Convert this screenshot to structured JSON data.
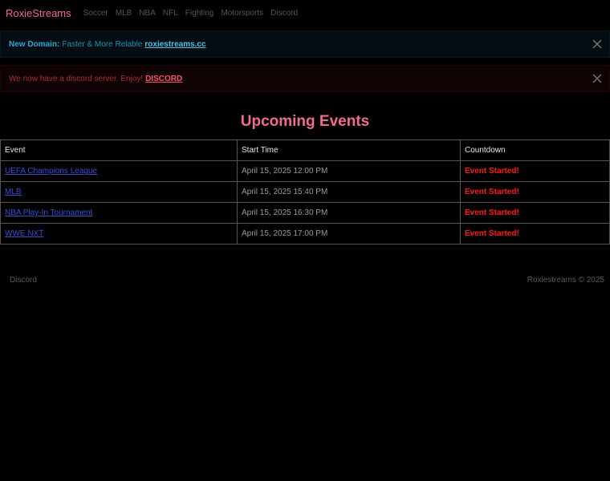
{
  "navbar": {
    "brand": "RoxieStreams",
    "links": [
      "Soccer",
      "MLB",
      "NBA",
      "NFL",
      "Fighting",
      "Motorsports",
      "Discord"
    ]
  },
  "alerts": {
    "domain": {
      "lead": "New Domain:",
      "text": "Faster & More Relable",
      "link": "roxiestreams.cc"
    },
    "discord": {
      "text": "We now have a discord server. Enjoy!",
      "link": "DISCORD"
    }
  },
  "main": {
    "title": "Upcoming Events",
    "table": {
      "headers": [
        "Event",
        "Start Time",
        "Countdown"
      ],
      "rows": [
        {
          "event": "UEFA Champions League",
          "start": "April 15, 2025 12:00 PM",
          "countdown": "Event Started!"
        },
        {
          "event": "MLB",
          "start": "April 15, 2025 15:40 PM",
          "countdown": "Event Started!"
        },
        {
          "event": "NBA Play-In Tournament",
          "start": "April 15, 2025 16:30 PM",
          "countdown": "Event Started!"
        },
        {
          "event": "WWE NXT",
          "start": "April 15, 2025 17:00 PM",
          "countdown": "Event Started!"
        }
      ]
    }
  },
  "footer": {
    "left": "Discord",
    "right": "Roxiestreams © 2025"
  },
  "colors": {
    "brand": "#f06b8e",
    "started": "#ff1a1a",
    "link": "#3a4fd0",
    "info": "#2aa8d4",
    "danger": "#ff4f6a"
  }
}
